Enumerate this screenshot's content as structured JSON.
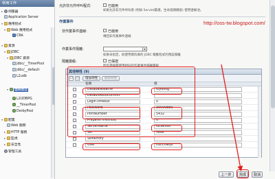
{
  "sidebar": {
    "title": "常用工作",
    "items": [
      {
        "label": "伺服器",
        "icon": "server-icon",
        "twisty": "▸"
      },
      {
        "label": "Application Server",
        "icon": "document-icon",
        "twisty": ""
      },
      {
        "label": "應用程式",
        "icon": "folder-icon",
        "twisty": "▾"
      },
      {
        "label": "Web 應用程式",
        "icon": "folder-icon",
        "twisty": "▾"
      },
      {
        "label": "CRA",
        "icon": "app-icon",
        "twisty": ""
      },
      {
        "label": "資源",
        "icon": "folder-icon",
        "twisty": "▾"
      },
      {
        "label": "JDBC",
        "icon": "folder-icon",
        "twisty": "▾"
      },
      {
        "label": "JDBC 資源",
        "icon": "folder-icon",
        "twisty": "▾"
      },
      {
        "label": "jdbc/__TimerPool",
        "icon": "document-icon",
        "twisty": ""
      },
      {
        "label": "jdbc/__default",
        "icon": "document-icon",
        "twisty": ""
      },
      {
        "label": "L2udb",
        "icon": "document-icon",
        "twisty": ""
      },
      {
        "label": "連線集區",
        "icon": "database-icon",
        "twisty": "▾"
      },
      {
        "label": "L2UDBPG",
        "icon": "database-icon",
        "twisty": ""
      },
      {
        "label": "__TimerPool",
        "icon": "database-icon",
        "twisty": ""
      },
      {
        "label": "DerbyPool",
        "icon": "database-icon",
        "twisty": ""
      },
      {
        "label": "配置",
        "icon": "folder-icon",
        "twisty": "▾"
      },
      {
        "label": "Web 服務",
        "icon": "document-icon",
        "twisty": ""
      },
      {
        "label": "HTTP 服務",
        "icon": "folder-icon",
        "twisty": "▸"
      },
      {
        "label": "監視",
        "icon": "folder-icon",
        "twisty": "▸"
      },
      {
        "label": "安全性",
        "icon": "folder-icon",
        "twisty": "▸"
      },
      {
        "label": "管理工具",
        "icon": "gear-icon",
        "twisty": ""
      }
    ]
  },
  "main": {
    "allow_non_component_callers": {
      "label": "允許非元件呼叫程式:",
      "checkbox_label": "已啟用",
      "help": "如果允許非元件呼叫者 (例如 Servlet篩選，生命週期模組) 使用連線池。"
    },
    "section_transaction": "作業事件",
    "non_transactional": {
      "label": "非作業事件連線:",
      "checkbox_label": "已啟用",
      "help": "傳回非作業事件連線"
    },
    "isolation": {
      "label": "作業事件隔離:",
      "help": "如果未指定，則使用資料庫的 JDBC 驅動程式的預設隔離"
    },
    "guaranteed": {
      "label": "隔離層級:",
      "checkbox_label": "已保證",
      "help": "所有連線都使用相同的作業事件隔離層級"
    },
    "url_annotation": "http://oss-tw.blogspot.com/"
  },
  "properties": {
    "title": "其他特性 (9)",
    "add_label": "增加特性",
    "delete_label": "刪除特性",
    "col_name": "名稱",
    "col_value": "值",
    "rows": [
      {
        "name": "DatabaseName",
        "value": "l2ydoog"
      },
      {
        "name": "DefaultAutoCommit",
        "value": ""
      },
      {
        "name": "LoginTimeout",
        "value": "0"
      },
      {
        "name": "Password",
        "value": "39099889"
      },
      {
        "name": "PortNumber",
        "value": "5432"
      },
      {
        "name": "PrepareThreshold",
        "value": "0"
      },
      {
        "name": "ServerName",
        "value": "localhost"
      },
      {
        "name": "Ssl",
        "value": "false"
      },
      {
        "name": "Sslfactory",
        "value": ""
      },
      {
        "name": "User",
        "value": "itucchaoyi"
      }
    ]
  },
  "footer": {
    "prev_label": "上一步",
    "finish_label": "完成",
    "cancel_label": "取消"
  },
  "colors": {
    "annotation": "#e31b1b",
    "selection": "#3d67b1",
    "header": "#56739a"
  }
}
